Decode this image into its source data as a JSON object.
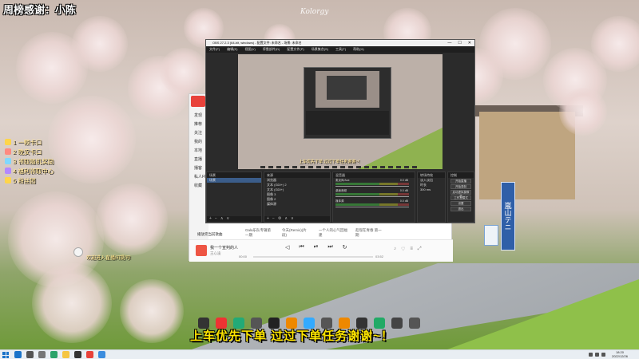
{
  "overlay": {
    "title": "周榜感谢：小陈",
    "watermark": "Kolorgy",
    "commands": [
      {
        "label": "1 一颗卡口",
        "color": "#ffd54a"
      },
      {
        "label": "2 晚安卡口",
        "color": "#ff8a80"
      },
      {
        "label": "3 领取随机奖励",
        "color": "#80d8ff"
      },
      {
        "label": "4 福利领取中心",
        "color": "#b388ff"
      },
      {
        "label": "5 粉丝团",
        "color": "#ffd54a"
      }
    ],
    "chat_text": "欢迎进入直播间提问!",
    "caption": "上车优先下单  过过下单任务谢谢~！",
    "sign_text": "嵐山テニ"
  },
  "app_window": {
    "left_menu": [
      "发现",
      "推荐",
      "关注",
      "我的",
      "本地",
      "直播",
      "播客",
      "私人FM",
      "收藏"
    ],
    "columns": [
      "Gala乐队专辑第一期",
      "今天(Remix)(片段)",
      "一个人的心气回福建",
      "趁现在青春 第一期"
    ],
    "checkbox_label": "播放完当前歌曲",
    "close_label": "关闭",
    "player": {
      "song": "我一个宣判的人",
      "artist": "王心凌",
      "time_current": "00:00",
      "time_total": "03:52",
      "controls": [
        "◁",
        "⏮",
        "⏯",
        "⏭",
        "↻"
      ],
      "right_icons": [
        "♪",
        "♡",
        "≡",
        "⤢"
      ]
    }
  },
  "obs": {
    "title": "OBS 27.2.3 (64-bit, windows) - 配置文件: 未命名 - 场景: 未命名",
    "window_controls": [
      "—",
      "☐",
      "✕"
    ],
    "menu": [
      "文件(F)",
      "编辑(E)",
      "视图(V)",
      "停靠部件(D)",
      "配置文件(P)",
      "场景集合(S)",
      "工具(T)",
      "帮助(H)"
    ],
    "preview_text": "上车优先下单 过过下单任务谢谢~！",
    "docks": {
      "scenes_title": "场景",
      "scenes": [
        "场景"
      ],
      "sources_title": "来源",
      "sources": [
        "浏览器",
        "文本 (GDI+) 2",
        "文本 (GDI+)",
        "图像 3",
        "图像 2",
        "媒体源"
      ],
      "mixer_title": "混音器",
      "mixer": [
        {
          "name": "麦克风/Aux",
          "db": "0.0 dB"
        },
        {
          "name": "桌面音频",
          "db": "0.0 dB"
        },
        {
          "name": "媒体源",
          "db": "0.0 dB"
        }
      ],
      "transitions_title": "转场特效",
      "transition_type": "淡入淡出",
      "transition_duration_label": "时长",
      "transition_duration": "300 ms",
      "controls_title": "控制",
      "controls": [
        "开始直播",
        "开始录制",
        "启动虚拟摄像机",
        "工作室模式",
        "设置",
        "退出"
      ],
      "toolbar": [
        "+",
        "−",
        "⚙",
        "∧",
        "∨"
      ]
    },
    "status": "LIVE: 00:00:00   REC: 00:00:00   CPU: 3.1%, 30.00 fps"
  },
  "taskbar": {
    "clock_time": "18:20",
    "clock_date": "2022/12/26",
    "apps": [
      {
        "name": "start-app",
        "color": "#1a73c9"
      },
      {
        "name": "search-app",
        "color": "#555555"
      },
      {
        "name": "taskview-app",
        "color": "#777777"
      },
      {
        "name": "edge-app",
        "color": "#2ba36b"
      },
      {
        "name": "explorer-app",
        "color": "#f5c542"
      },
      {
        "name": "obs-app",
        "color": "#333333"
      },
      {
        "name": "music-app",
        "color": "#e8423b"
      },
      {
        "name": "chat-app",
        "color": "#3c8dde"
      }
    ]
  },
  "caption_icon_colors": [
    "#333",
    "#e33",
    "#2a7",
    "#555",
    "#222",
    "#e80",
    "#3af",
    "#555",
    "#e80",
    "#333",
    "#2a6",
    "#444",
    "#555"
  ]
}
